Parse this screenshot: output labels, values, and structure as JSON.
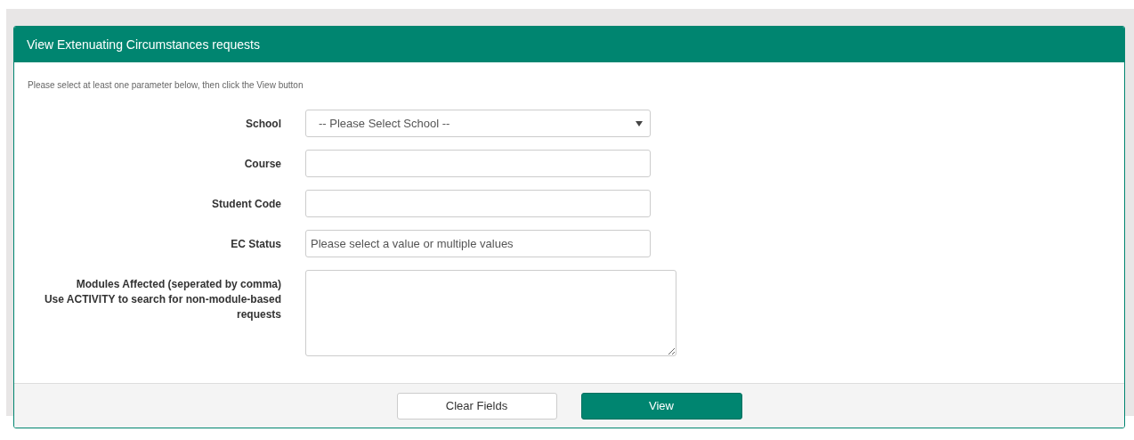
{
  "panel": {
    "title": "View Extenuating Circumstances requests"
  },
  "instructions": "Please select at least one parameter below, then click the View button",
  "fields": [
    {
      "kind": "select",
      "label": "School",
      "value": "-- Please Select School --"
    },
    {
      "kind": "text",
      "label": "Course"
    },
    {
      "kind": "text",
      "label": "Student Code"
    },
    {
      "kind": "multiselect",
      "label": "EC Status",
      "placeholder": "Please select a value or multiple values"
    },
    {
      "kind": "textarea",
      "label": "Modules Affected (seperated by comma)",
      "hint": "Use ACTIVITY to search for non-module-based requests"
    }
  ],
  "buttons": [
    {
      "kind": "secondary",
      "label": "Clear Fields"
    },
    {
      "kind": "primary",
      "label": "View"
    }
  ]
}
